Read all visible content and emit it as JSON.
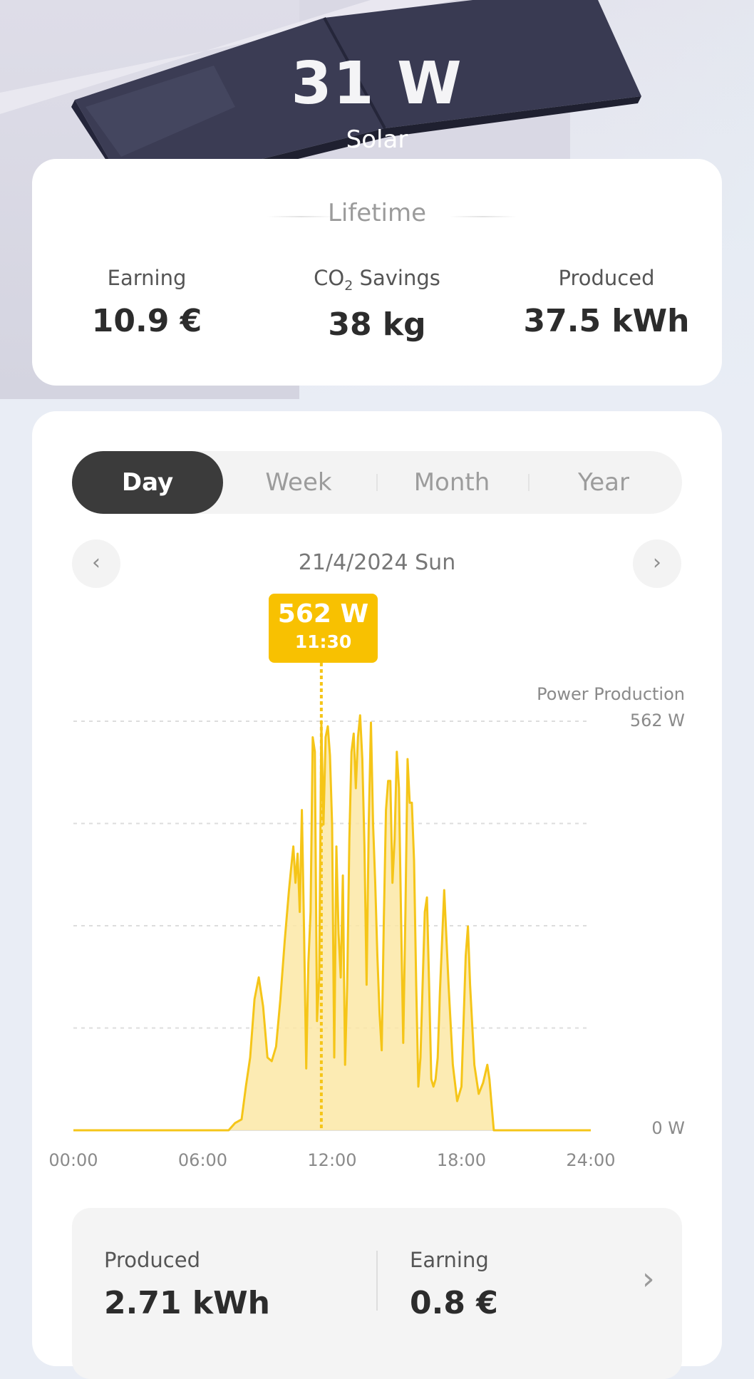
{
  "hero": {
    "value": "31 W",
    "label": "Solar"
  },
  "lifetime": {
    "title": "Lifetime",
    "stats": [
      {
        "label": "Earning",
        "value": "10.9 €"
      },
      {
        "label_prefix": "CO",
        "label_sub": "2",
        "label_suffix": " Savings",
        "value": "38 kg"
      },
      {
        "label": "Produced",
        "value": "37.5 kWh"
      }
    ]
  },
  "tabs": [
    {
      "label": "Day",
      "active": true
    },
    {
      "label": "Week",
      "active": false
    },
    {
      "label": "Month",
      "active": false
    },
    {
      "label": "Year",
      "active": false
    }
  ],
  "date_nav": {
    "date": "21/4/2024 Sun",
    "prev_icon": "chevron-left-icon",
    "next_icon": "chevron-right-icon"
  },
  "tooltip": {
    "value": "562 W",
    "time": "11:30"
  },
  "chart_data": {
    "type": "area",
    "series_label": "Power Production",
    "y_max_label": "562 W",
    "y_min_label": "0 W",
    "ylim": [
      0,
      562
    ],
    "xlim": [
      0,
      24
    ],
    "x_ticks": [
      "00:00",
      "06:00",
      "12:00",
      "18:00",
      "24:00"
    ],
    "color": "#f5c518",
    "fill": "#fbe7a6",
    "grid": true,
    "highlight": {
      "x": 11.5,
      "y": 562
    },
    "points": [
      [
        0,
        0
      ],
      [
        7.2,
        0
      ],
      [
        7.5,
        10
      ],
      [
        7.8,
        15
      ],
      [
        8,
        60
      ],
      [
        8.2,
        100
      ],
      [
        8.4,
        180
      ],
      [
        8.6,
        210
      ],
      [
        8.8,
        170
      ],
      [
        9,
        100
      ],
      [
        9.2,
        95
      ],
      [
        9.4,
        115
      ],
      [
        9.6,
        180
      ],
      [
        9.8,
        260
      ],
      [
        10,
        330
      ],
      [
        10.1,
        360
      ],
      [
        10.2,
        390
      ],
      [
        10.3,
        340
      ],
      [
        10.4,
        380
      ],
      [
        10.5,
        300
      ],
      [
        10.6,
        440
      ],
      [
        10.7,
        270
      ],
      [
        10.8,
        85
      ],
      [
        10.9,
        230
      ],
      [
        11,
        300
      ],
      [
        11.1,
        540
      ],
      [
        11.2,
        520
      ],
      [
        11.3,
        150
      ],
      [
        11.4,
        210
      ],
      [
        11.5,
        562
      ],
      [
        11.6,
        420
      ],
      [
        11.7,
        540
      ],
      [
        11.8,
        555
      ],
      [
        11.9,
        515
      ],
      [
        12,
        420
      ],
      [
        12.1,
        100
      ],
      [
        12.2,
        390
      ],
      [
        12.3,
        270
      ],
      [
        12.4,
        210
      ],
      [
        12.5,
        350
      ],
      [
        12.6,
        90
      ],
      [
        12.7,
        200
      ],
      [
        12.8,
        400
      ],
      [
        12.9,
        520
      ],
      [
        13,
        545
      ],
      [
        13.1,
        470
      ],
      [
        13.2,
        540
      ],
      [
        13.3,
        570
      ],
      [
        13.4,
        510
      ],
      [
        13.5,
        390
      ],
      [
        13.6,
        200
      ],
      [
        13.7,
        420
      ],
      [
        13.8,
        560
      ],
      [
        13.9,
        420
      ],
      [
        14,
        340
      ],
      [
        14.1,
        240
      ],
      [
        14.2,
        160
      ],
      [
        14.3,
        110
      ],
      [
        14.4,
        290
      ],
      [
        14.5,
        440
      ],
      [
        14.6,
        480
      ],
      [
        14.7,
        480
      ],
      [
        14.8,
        340
      ],
      [
        14.9,
        400
      ],
      [
        15,
        520
      ],
      [
        15.1,
        470
      ],
      [
        15.2,
        290
      ],
      [
        15.3,
        120
      ],
      [
        15.4,
        300
      ],
      [
        15.5,
        510
      ],
      [
        15.6,
        450
      ],
      [
        15.7,
        450
      ],
      [
        15.8,
        370
      ],
      [
        15.9,
        200
      ],
      [
        16,
        60
      ],
      [
        16.1,
        100
      ],
      [
        16.2,
        200
      ],
      [
        16.3,
        300
      ],
      [
        16.4,
        320
      ],
      [
        16.5,
        200
      ],
      [
        16.6,
        70
      ],
      [
        16.7,
        60
      ],
      [
        16.8,
        70
      ],
      [
        16.9,
        100
      ],
      [
        17,
        190
      ],
      [
        17.2,
        330
      ],
      [
        17.4,
        200
      ],
      [
        17.6,
        90
      ],
      [
        17.8,
        40
      ],
      [
        18,
        60
      ],
      [
        18.2,
        240
      ],
      [
        18.3,
        280
      ],
      [
        18.4,
        200
      ],
      [
        18.6,
        90
      ],
      [
        18.8,
        50
      ],
      [
        19,
        65
      ],
      [
        19.2,
        90
      ],
      [
        19.3,
        70
      ],
      [
        19.4,
        35
      ],
      [
        19.5,
        0
      ],
      [
        24,
        0
      ]
    ]
  },
  "summary": {
    "produced_label": "Produced",
    "produced_value": "2.71 kWh",
    "earning_label": "Earning",
    "earning_value": "0.8 €"
  }
}
